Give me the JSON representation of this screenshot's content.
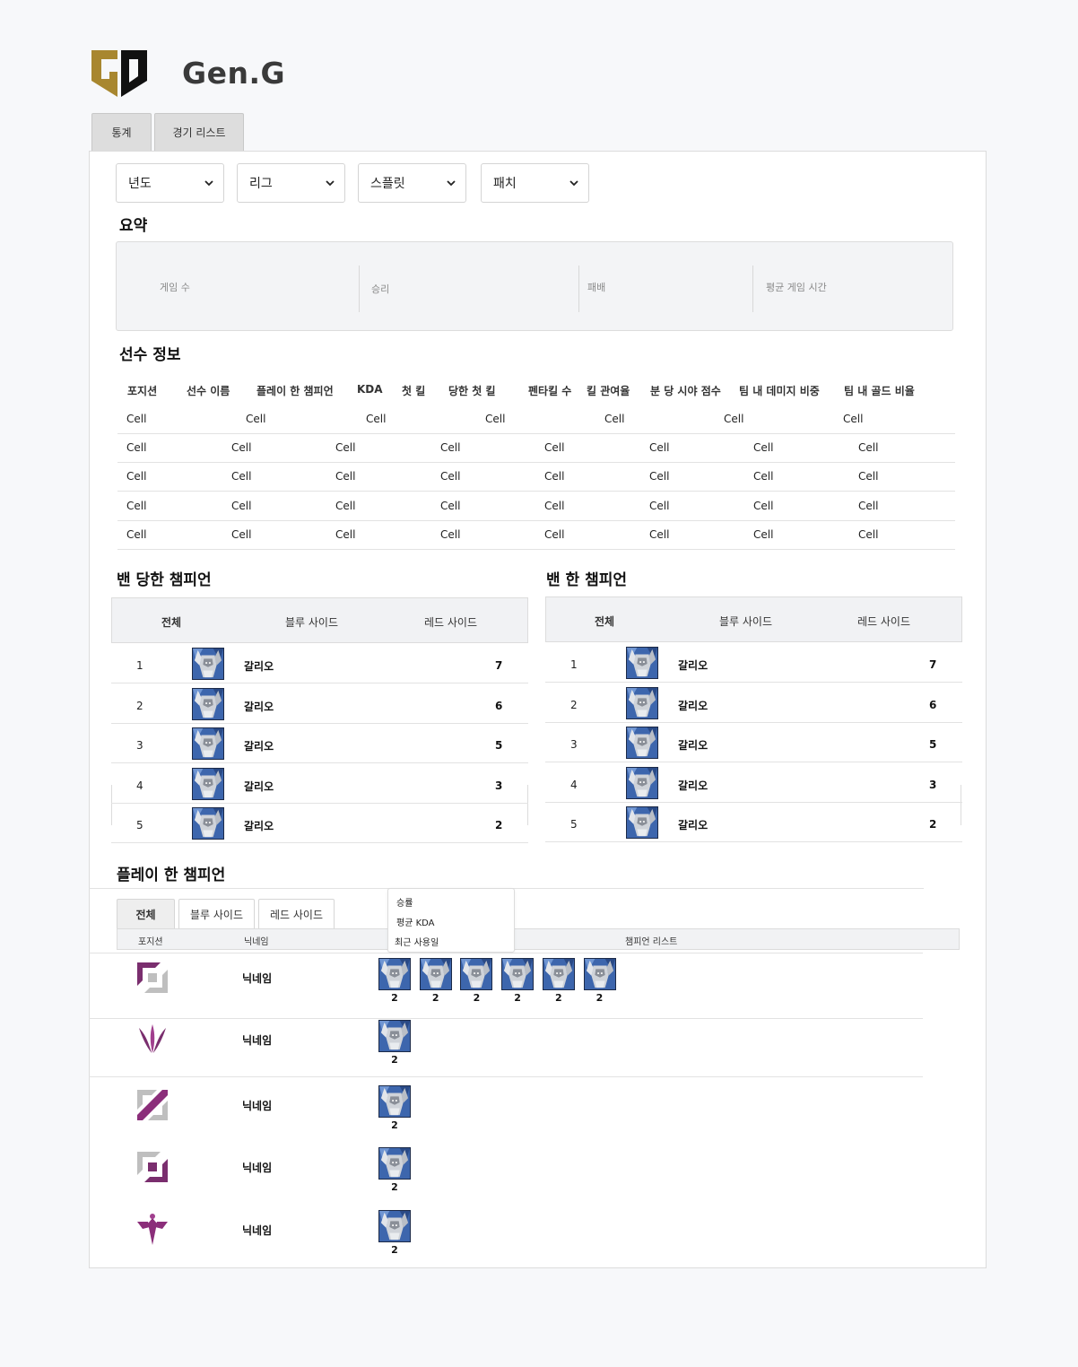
{
  "brand": {
    "name": "Gen.G"
  },
  "tabs": [
    {
      "label": "통계"
    },
    {
      "label": "경기 리스트"
    }
  ],
  "filters": [
    {
      "value": "년도"
    },
    {
      "value": "리그"
    },
    {
      "value": "스플릿"
    },
    {
      "value": "패치"
    }
  ],
  "summary": {
    "title": "요약",
    "labels": [
      "게임 수",
      "승리",
      "패배",
      "평균 게임 시간"
    ]
  },
  "players": {
    "title": "선수 정보",
    "headers": [
      "포지션",
      "선수 이름",
      "플레이 한 챔피언",
      "KDA",
      "첫 킬",
      "당한 첫 킬",
      "펜타킬 수",
      "킬 관여율",
      "분 당 시야 점수",
      "팀 내 데미지 비중",
      "팀 내 골드 비율"
    ],
    "first_row": [
      "Cell",
      "Cell",
      "Cell",
      "Cell",
      "Cell",
      "Cell",
      "Cell"
    ],
    "rows": [
      [
        "Cell",
        "Cell",
        "Cell",
        "Cell",
        "Cell",
        "Cell",
        "Cell",
        "Cell"
      ],
      [
        "Cell",
        "Cell",
        "Cell",
        "Cell",
        "Cell",
        "Cell",
        "Cell",
        "Cell"
      ],
      [
        "Cell",
        "Cell",
        "Cell",
        "Cell",
        "Cell",
        "Cell",
        "Cell",
        "Cell"
      ],
      [
        "Cell",
        "Cell",
        "Cell",
        "Cell",
        "Cell",
        "Cell",
        "Cell",
        "Cell"
      ]
    ]
  },
  "banned_against": {
    "title": "밴 당한 챔피언",
    "headers": [
      "전체",
      "블루 사이드",
      "레드 사이드"
    ],
    "rows": [
      {
        "rank": "1",
        "champion": "갈리오",
        "count": "7"
      },
      {
        "rank": "2",
        "champion": "갈리오",
        "count": "6"
      },
      {
        "rank": "3",
        "champion": "갈리오",
        "count": "5"
      },
      {
        "rank": "4",
        "champion": "갈리오",
        "count": "3"
      },
      {
        "rank": "5",
        "champion": "갈리오",
        "count": "2"
      }
    ]
  },
  "banned_by": {
    "title": "밴 한 챔피언",
    "headers": [
      "전체",
      "블루 사이드",
      "레드 사이드"
    ],
    "rows": [
      {
        "rank": "1",
        "champion": "갈리오",
        "count": "7"
      },
      {
        "rank": "2",
        "champion": "갈리오",
        "count": "6"
      },
      {
        "rank": "3",
        "champion": "갈리오",
        "count": "5"
      },
      {
        "rank": "4",
        "champion": "갈리오",
        "count": "3"
      },
      {
        "rank": "5",
        "champion": "갈리오",
        "count": "2"
      }
    ]
  },
  "played": {
    "title": "플레이 한 챔피언",
    "tabs": [
      "전체",
      "블루 사이드",
      "레드 사이드"
    ],
    "headers": [
      "포지션",
      "닉네임",
      "챔피언 리스트"
    ],
    "sort_options": [
      "승률",
      "평균 KDA",
      "최근 사용일"
    ],
    "rows": [
      {
        "position_icon": "top-position-icon",
        "nickname": "닉네임",
        "counts": [
          "2",
          "2",
          "2",
          "2",
          "2",
          "2"
        ]
      },
      {
        "position_icon": "jungle-position-icon",
        "nickname": "닉네임",
        "counts": [
          "2"
        ]
      },
      {
        "position_icon": "mid-position-icon",
        "nickname": "닉네임",
        "counts": [
          "2"
        ]
      },
      {
        "position_icon": "bottom-position-icon",
        "nickname": "닉네임",
        "counts": [
          "2"
        ]
      },
      {
        "position_icon": "support-position-icon",
        "nickname": "닉네임",
        "counts": [
          "2"
        ]
      }
    ]
  },
  "colors": {
    "brand_gold": "#a8872f",
    "position_purple": "#7a2e6e",
    "champion_blue": "#3d66ad"
  }
}
